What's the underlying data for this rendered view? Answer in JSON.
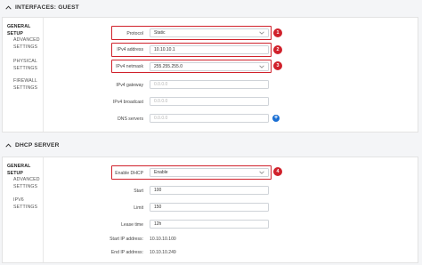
{
  "sections": {
    "interfaces": {
      "title": "INTERFACES: GUEST"
    },
    "dhcp": {
      "title": "DHCP SERVER"
    }
  },
  "sidebar1": {
    "items": [
      "GENERAL SETUP",
      "ADVANCED SETTINGS",
      "PHYSICAL SETTINGS",
      "FIREWALL SETTINGS"
    ],
    "active_index": 0
  },
  "general": {
    "protocol": {
      "label": "Protocol",
      "value": "Static"
    },
    "ipv4_address": {
      "label": "IPv4 address",
      "value": "10.10.10.1"
    },
    "ipv4_netmask": {
      "label": "IPv4 netmask",
      "value": "255.255.255.0"
    },
    "ipv4_gateway": {
      "label": "IPv4 gateway",
      "placeholder": "0.0.0.0"
    },
    "ipv4_broadcast": {
      "label": "IPv4 broadcast",
      "placeholder": "0.0.0.0"
    },
    "dns_servers": {
      "label": "DNS servers",
      "placeholder": "0.0.0.0"
    }
  },
  "sidebar2": {
    "items": [
      "GENERAL SETUP",
      "ADVANCED SETTINGS",
      "IPV6 SETTINGS"
    ],
    "active_index": 0
  },
  "dhcp": {
    "enable_dhcp": {
      "label": "Enable DHCP",
      "value": "Enable"
    },
    "start": {
      "label": "Start",
      "value": "100"
    },
    "limit": {
      "label": "Limit",
      "value": "150"
    },
    "lease_time": {
      "label": "Lease time",
      "value": "12h"
    },
    "start_ip": {
      "label": "Start IP address:",
      "value": "10.10.10.100"
    },
    "end_ip": {
      "label": "End IP address:",
      "value": "10.10.10.249"
    }
  },
  "markers": [
    "1",
    "2",
    "3",
    "4"
  ],
  "colors": {
    "highlight": "#d0212b",
    "accent": "#1a6fd3"
  },
  "icons": {
    "collapse": "chevron-up-icon",
    "dropdown": "chevron-down-icon",
    "add": "plus-circle-icon"
  }
}
